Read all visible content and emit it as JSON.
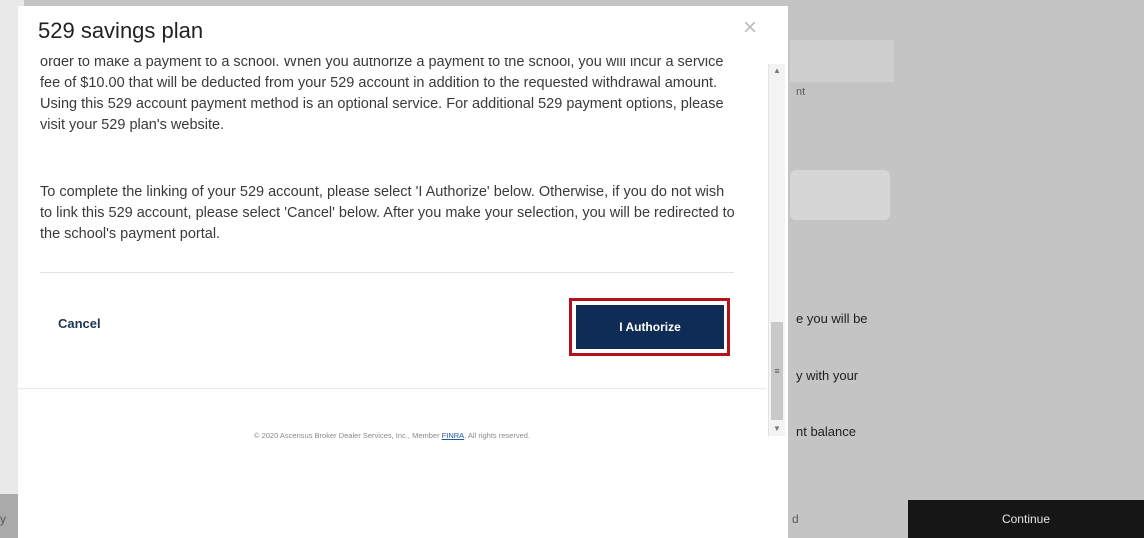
{
  "background": {
    "field_fragment": "nt",
    "text_fragments": [
      "e you will be",
      "y with your",
      "nt balance"
    ],
    "back_fragment": "y",
    "mid_fragment": "d",
    "continue_label": "Continue"
  },
  "modal": {
    "title": "529 savings plan",
    "close_icon": "close-icon",
    "paragraph1": "order to make a payment to a school. When you authorize a payment to the school, you will incur a service fee of $10.00 that will be deducted from your 529 account in addition to the requested withdrawal amount. Using this 529 account payment method is an optional service. For additional 529 payment options, please visit your 529 plan's website.",
    "paragraph2": "To complete the linking of your 529 account, please select 'I Authorize' below. Otherwise, if you do not wish to link this 529 account, please select 'Cancel' below. After you make your selection, you will be redirected to the school's payment portal.",
    "cancel_label": "Cancel",
    "authorize_label": "I Authorize",
    "footer_prefix": "© 2020 Ascensus Broker Dealer Services, Inc., Member",
    "footer_link": "FINRA",
    "footer_suffix": ". All rights reserved."
  },
  "colors": {
    "highlight": "#b5121b",
    "button": "#0e2c55"
  }
}
